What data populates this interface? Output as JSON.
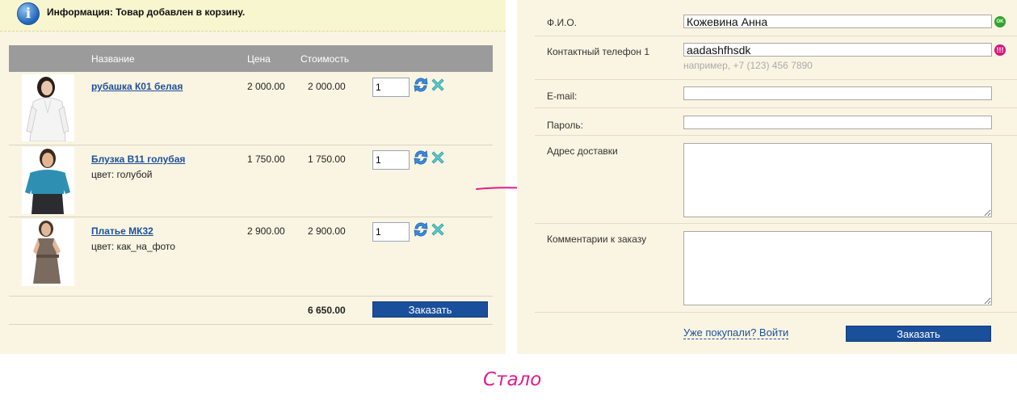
{
  "notice": {
    "text": "Информация: Товар добавлен в корзину.",
    "icon": "info-icon"
  },
  "cart": {
    "columns": {
      "name": "Название",
      "price": "Цена",
      "cost": "Стоимость"
    },
    "items": [
      {
        "name": "рубашка К01 белая",
        "color": "",
        "price": "2 000.00",
        "cost": "2 000.00",
        "qty": "1"
      },
      {
        "name": "Блузка B11 голубая",
        "color": "цвет: голубой",
        "price": "1 750.00",
        "cost": "1 750.00",
        "qty": "1"
      },
      {
        "name": "Платье МК32",
        "color": "цвет: как_на_фото",
        "price": "2 900.00",
        "cost": "2 900.00",
        "qty": "1"
      }
    ],
    "total": "6 650.00",
    "order_label": "Заказать"
  },
  "form": {
    "fio_label": "Ф.И.О.",
    "fio_value": "Кожевина Анна",
    "fio_status": "OK",
    "phone_label": "Контактный телефон 1",
    "phone_value": "aadashfhsdk",
    "phone_status": "!!!",
    "phone_hint": "например, +7 (123) 456 7890",
    "email_label": "E-mail:",
    "password_label": "Пароль:",
    "address_label": "Адрес доставки",
    "comment_label": "Комментарии к заказу",
    "login_link": "Уже покупали? Войти",
    "order_label": "Заказать"
  },
  "caption": "Стало",
  "colors": {
    "accent": "#1a4f9c",
    "link": "#1d4f9a",
    "ok": "#33a331",
    "warn": "#d2187e",
    "caption": "#e21c8b",
    "panel": "#faf5e2"
  }
}
